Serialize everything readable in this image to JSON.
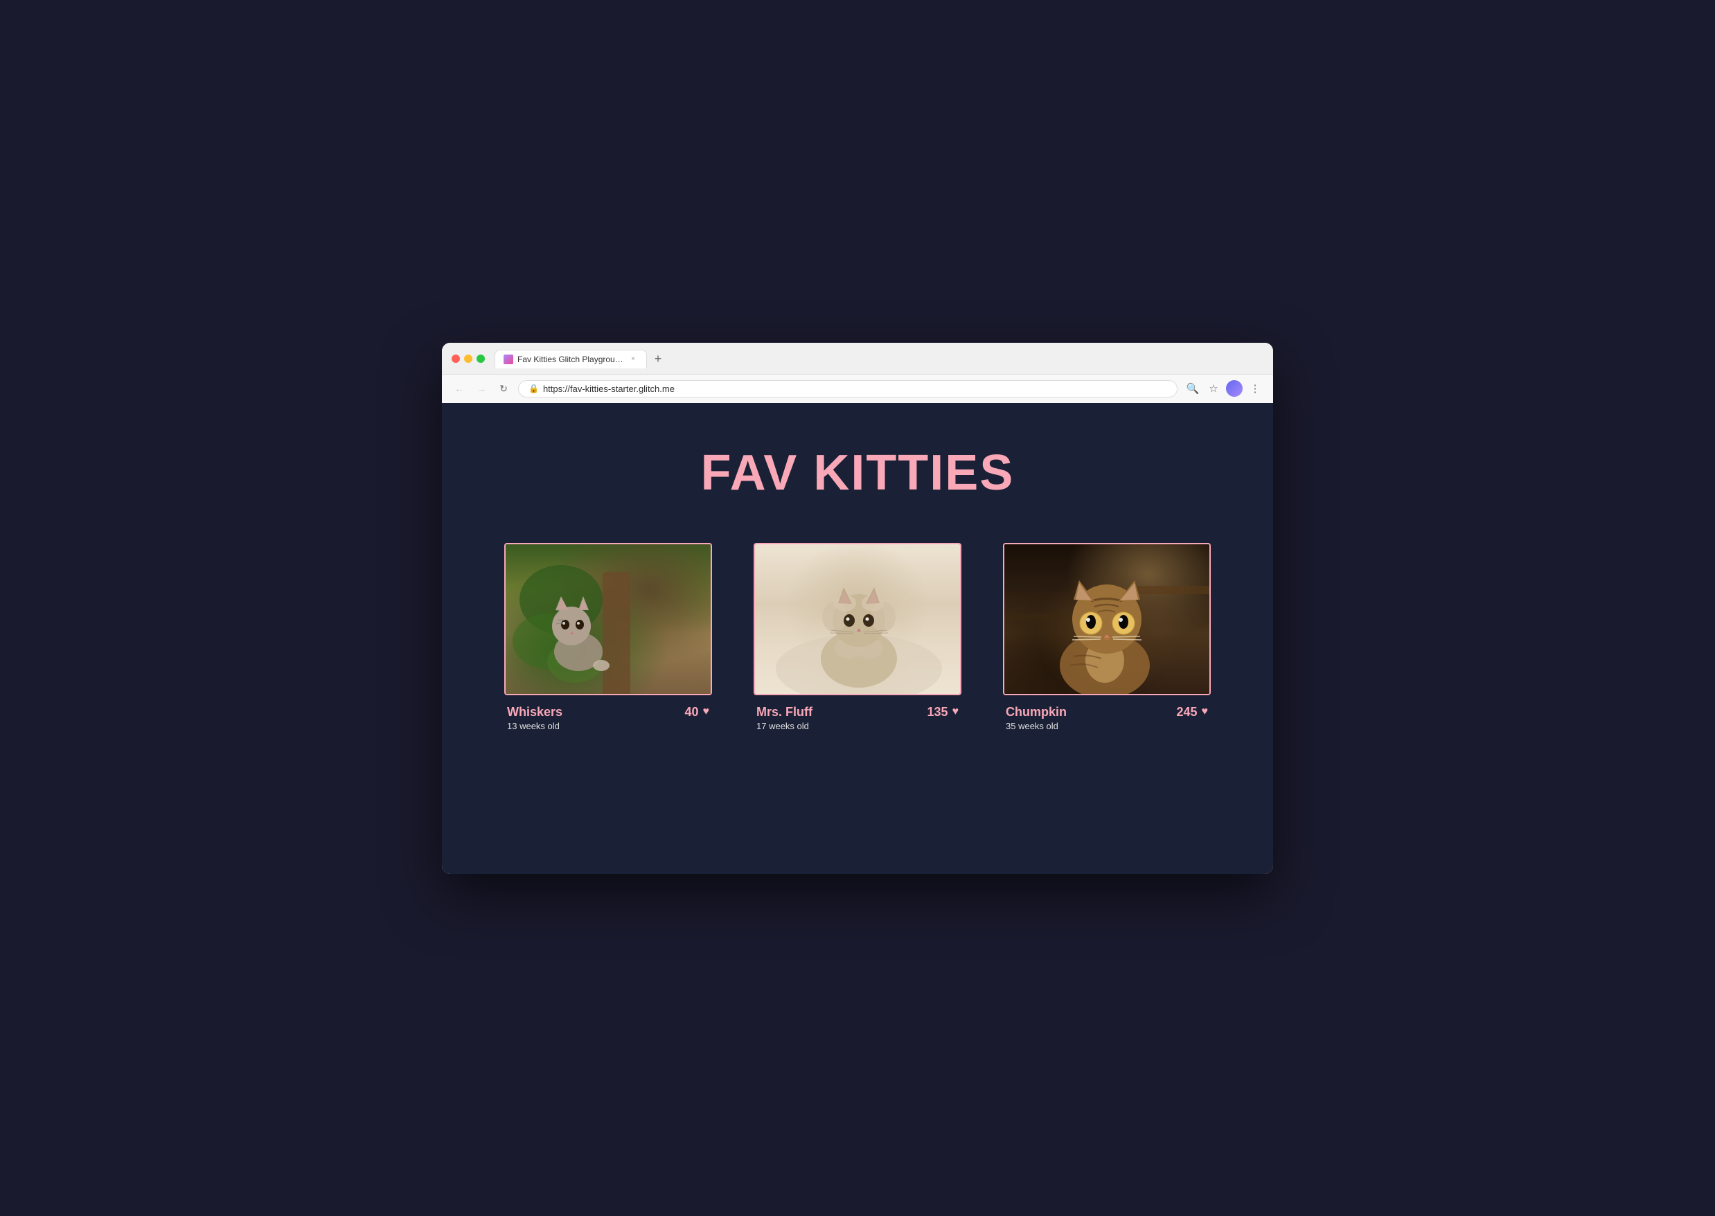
{
  "browser": {
    "tab_title": "Fav Kitties Glitch Playground",
    "tab_close": "×",
    "tab_new": "+",
    "url": "https://fav-kitties-starter.glitch.me",
    "nav": {
      "back_disabled": true,
      "forward_disabled": true
    }
  },
  "page": {
    "title": "FAV KITTIES",
    "background_color": "#1a2035",
    "accent_color": "#f9a8b8",
    "cats": [
      {
        "id": "whiskers",
        "name": "Whiskers",
        "age": "13 weeks old",
        "votes": 40,
        "art_class": "whiskers-art",
        "emoji": "🐱"
      },
      {
        "id": "mrsfluff",
        "name": "Mrs. Fluff",
        "age": "17 weeks old",
        "votes": 135,
        "art_class": "mrsfluff-art",
        "emoji": "🐈"
      },
      {
        "id": "chumpkin",
        "name": "Chumpkin",
        "age": "35 weeks old",
        "votes": 245,
        "art_class": "chumpkin-art",
        "emoji": "🐆"
      }
    ]
  }
}
